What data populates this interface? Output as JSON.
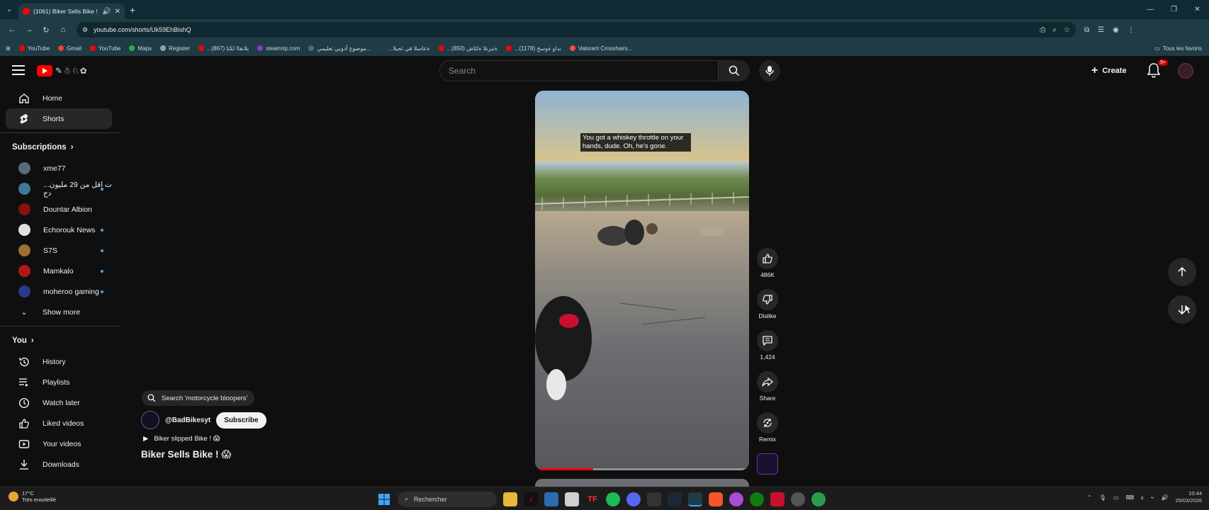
{
  "browser": {
    "tab_title": "(1061) Biker Sells Bike ! 😱 -",
    "url": "youtube.com/shorts/Uk59EhBishQ",
    "bookmarks": [
      {
        "label": "YouTube",
        "color": "#ff0000"
      },
      {
        "label": "Gmail",
        "color": "#ea4335"
      },
      {
        "label": "YouTube",
        "color": "#ff0000"
      },
      {
        "label": "Maps",
        "color": "#34a853"
      },
      {
        "label": "Register",
        "color": "#9aa0a6"
      },
      {
        "label": "...بلانقاا لكتا (867)",
        "color": "#ff0000"
      },
      {
        "label": "steamrip.com",
        "color": "#7b3fd0"
      },
      {
        "label": "موضوع أدوبي تعليمي...",
        "color": "#4a6a8a"
      },
      {
        "label": "...ةعاسلا في ثحبلا",
        "color": "#2a3a4a"
      },
      {
        "label": "...ةنبرنلا ةلئاش (850)",
        "color": "#ff0000"
      },
      {
        "label": "...نداو ةوسخ (1178)",
        "color": "#ff0000"
      },
      {
        "label": "Valorant Crosshairs...",
        "color": "#ff4655"
      }
    ],
    "bookmarks_right": "Tous les favoris"
  },
  "header": {
    "search_placeholder": "Search",
    "create_label": "Create",
    "notification_badge": "9+"
  },
  "sidebar": {
    "primary": [
      {
        "label": "Home",
        "icon": "home-icon"
      },
      {
        "label": "Shorts",
        "icon": "shorts-icon",
        "active": true
      }
    ],
    "subscriptions_title": "Subscriptions",
    "subscriptions": [
      {
        "label": "xme77",
        "color": "#5a6a7a",
        "live": false
      },
      {
        "label": "...ت اقل من 29 مليون دج",
        "color": "#3a7a9a",
        "live": true
      },
      {
        "label": "Dountar Albion",
        "color": "#8a1010",
        "live": false
      },
      {
        "label": "Echorouk News",
        "color": "#e0e0e0",
        "live": true
      },
      {
        "label": "S7S",
        "color": "#a07030",
        "live": true
      },
      {
        "label": "Mamkalo",
        "color": "#b01818",
        "live": true
      },
      {
        "label": "moheroo gaming",
        "color": "#2a3a8a",
        "live": true
      }
    ],
    "show_more": "Show more",
    "you_title": "You",
    "you_items": [
      {
        "label": "History",
        "icon": "history-icon"
      },
      {
        "label": "Playlists",
        "icon": "playlists-icon"
      },
      {
        "label": "Watch later",
        "icon": "watch-later-icon"
      },
      {
        "label": "Liked videos",
        "icon": "liked-videos-icon"
      },
      {
        "label": "Your videos",
        "icon": "your-videos-icon"
      },
      {
        "label": "Downloads",
        "icon": "downloads-icon"
      }
    ]
  },
  "short": {
    "caption_line1": "You got a whiskey throttle on your",
    "caption_line2": "hands, dude. Oh, he's gone.",
    "related_search": "Search 'motorcycle bloopers'",
    "channel": "@BadBikesyt",
    "subscribe_label": "Subscribe",
    "related_video": "Biker slipped Bike ! 😱",
    "title": "Biker Sells Bike ! 😱",
    "progress": 0.27
  },
  "actions": {
    "likes": "486K",
    "dislike_label": "Dislike",
    "comments": "1,424",
    "share_label": "Share",
    "remix_label": "Remix"
  },
  "taskbar": {
    "temperature": "17°C",
    "weather_text": "Très ensoleillé",
    "search_label": "Rechercher",
    "time": "10:44",
    "date": "25/03/2026"
  }
}
